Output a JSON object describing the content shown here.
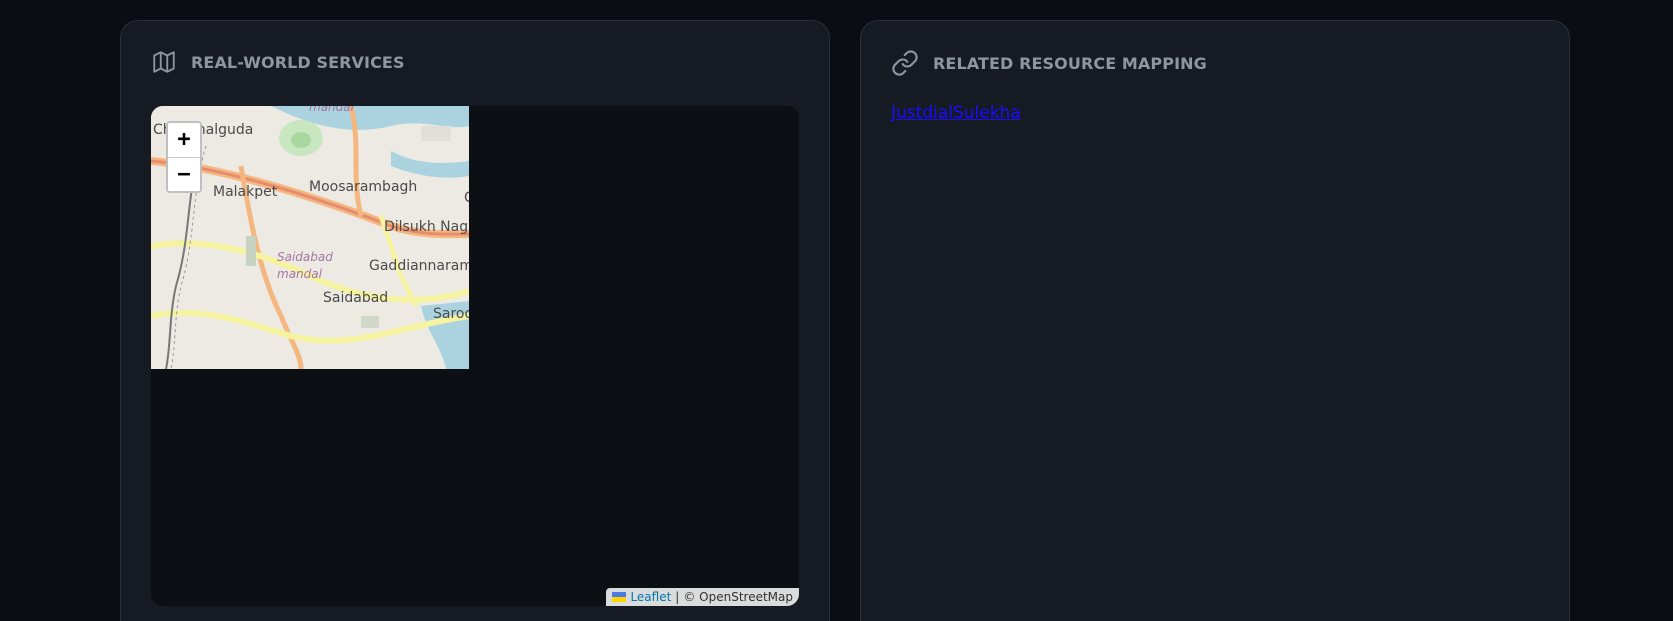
{
  "left_panel": {
    "title": "REAL-WORLD SERVICES",
    "icon": "map-icon",
    "map": {
      "zoom_in_label": "+",
      "zoom_out_label": "−",
      "places": [
        "Chanchalguda",
        "mandal",
        "Malakpet",
        "Moosarambagh",
        "Dilsukh Nag",
        "Saidabad mandal",
        "Gaddiannaram",
        "Saidabad",
        "Saroo",
        "C"
      ],
      "attribution_leaflet": "Leaflet",
      "attribution_sep": "|",
      "attribution_osm": "© OpenStreetMap"
    }
  },
  "right_panel": {
    "title": "RELATED RESOURCE MAPPING",
    "icon": "link-icon",
    "link_text": "JustdialSulekha"
  }
}
